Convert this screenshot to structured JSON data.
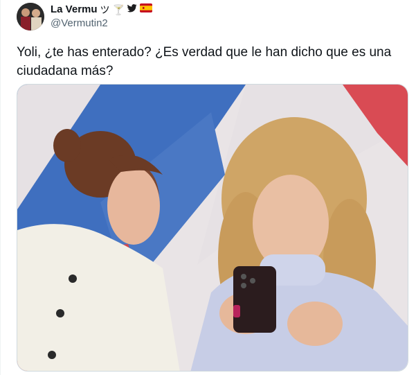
{
  "author": {
    "display_name": "La Vermu",
    "handle": "@Vermutin2",
    "name_emojis": [
      "ツ",
      "🍸"
    ],
    "badges": [
      "bird-icon",
      "spain-flag-icon"
    ]
  },
  "tweet": {
    "text_line1": "Yoli, ¿te has enterado? ¿Es verdad que le han dicho que es una",
    "text_line2": "ciudadana más?"
  },
  "colors": {
    "text": "#0f1419",
    "secondary": "#536471",
    "border": "#cfd9de",
    "photo_bg_blue": "#3f6fbf",
    "photo_bg_red": "#d94b54"
  }
}
